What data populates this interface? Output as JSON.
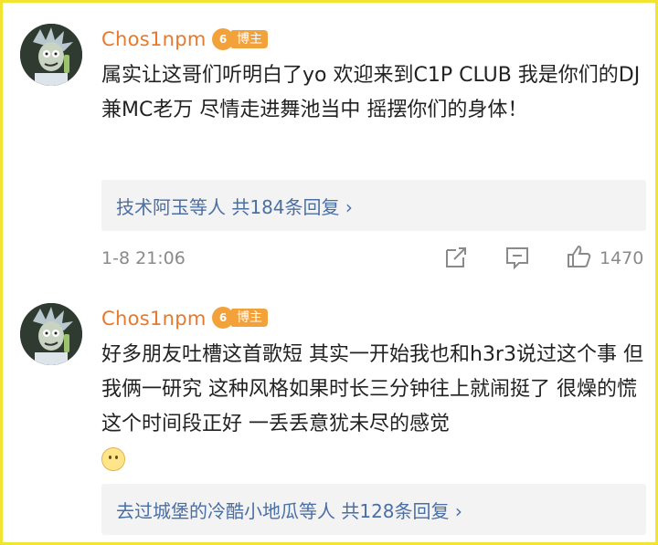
{
  "comments": [
    {
      "username": "Chos1npm",
      "level": "6",
      "badge": "博主",
      "text": "属实让这哥们听明白了yo 欢迎来到C1P CLUB 我是你们的DJ兼MC老万 尽情走进舞池当中 摇摆你们的身体！",
      "replies_who": "技术阿玉等人",
      "replies_count": "共184条回复",
      "replies_chevron": "›",
      "timestamp": "1-8 21:06",
      "likes": "1470"
    },
    {
      "username": "Chos1npm",
      "level": "6",
      "badge": "博主",
      "text": "好多朋友吐槽这首歌短 其实一开始我也和h3r3说过这个事 但我俩一研究 这种风格如果时长三分钟往上就闹挺了 很燥的慌 这个时间段正好 一丢丢意犹未尽的感觉",
      "emoji": "smile-emoji",
      "replies_who": "去过城堡的冷酷小地瓜等人",
      "replies_count": "共128条回复",
      "replies_chevron": "›"
    }
  ],
  "colors": {
    "username": "#e8792a",
    "badge": "#f3a13a",
    "link": "#4a6fa5",
    "meta": "#8a8a8a",
    "frame": "#f2e531"
  },
  "icons": [
    "share-icon",
    "comment-icon",
    "like-icon"
  ]
}
